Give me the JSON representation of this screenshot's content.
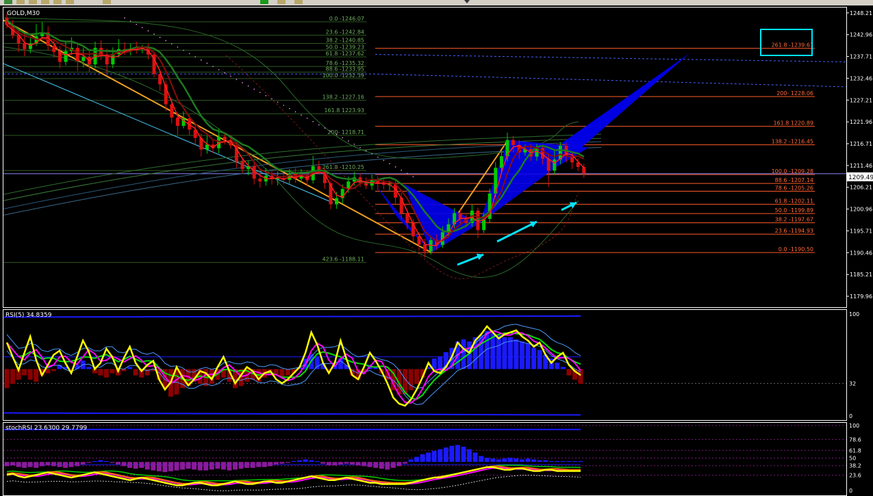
{
  "window": {
    "title": "GOLD,M30"
  },
  "toolbar": {
    "icons": [
      "app-icon",
      "tool-icon",
      "tool-icon",
      "tool-icon",
      "tool-icon",
      "tool-icon",
      "tool-icon",
      "plus-icon",
      "tool-icon",
      "tool-icon",
      "dropdown-icon"
    ]
  },
  "colors": {
    "background": "#000000",
    "bull_candle": "#00cc00",
    "bear_candle": "#dd1111",
    "fib_line_green": "#2f5a22",
    "fib_line_red": "#ff5a2a",
    "harmonic_fill": "#0000ee",
    "arrow": "#00e5ff",
    "highlight_box": "#00e5ff",
    "rsi_line": "#ffff00",
    "hist_pos": "#1a1aff",
    "hist_neg_rsi": "#8b0000",
    "hist_neg_stoch": "#8b1a9b"
  },
  "chart_data": [
    {
      "type": "candlestick",
      "title": "GOLD,M30",
      "ylim": [
        1177.5,
        1249.5
      ],
      "current_price": "1209.49",
      "y_ticks": [
        "1248.21",
        "1242.96",
        "1237.71",
        "1232.46",
        "1227.21",
        "1221.96",
        "1216.71",
        "1211.46",
        "1206.21",
        "1200.96",
        "1195.71",
        "1190.46",
        "1185.21",
        "1179.96"
      ],
      "candles": [
        [
          1247.0,
          1245.3,
          1248.0,
          1244.5
        ],
        [
          1245.3,
          1242.8,
          1246.5,
          1242.0
        ],
        [
          1242.8,
          1240.9,
          1244.0,
          1238.8
        ],
        [
          1240.9,
          1239.5,
          1243.2,
          1237.8
        ],
        [
          1239.5,
          1240.8,
          1242.6,
          1238.5
        ],
        [
          1240.8,
          1242.6,
          1245.5,
          1240.2
        ],
        [
          1242.6,
          1243.5,
          1246.0,
          1241.8
        ],
        [
          1243.5,
          1240.3,
          1245.0,
          1239.2
        ],
        [
          1240.3,
          1238.8,
          1241.5,
          1237.5
        ],
        [
          1238.8,
          1236.4,
          1240.2,
          1234.9
        ],
        [
          1236.4,
          1239.0,
          1241.2,
          1235.6
        ],
        [
          1239.0,
          1239.8,
          1242.3,
          1238.1
        ],
        [
          1239.8,
          1236.6,
          1241.1,
          1234.2
        ],
        [
          1236.6,
          1237.6,
          1239.9,
          1235.1
        ],
        [
          1237.6,
          1235.8,
          1239.4,
          1234.0
        ],
        [
          1235.8,
          1239.8,
          1241.3,
          1234.9
        ],
        [
          1239.8,
          1238.2,
          1241.6,
          1236.8
        ],
        [
          1238.2,
          1235.8,
          1239.6,
          1233.6
        ],
        [
          1235.8,
          1238.3,
          1239.9,
          1234.9
        ],
        [
          1238.3,
          1239.5,
          1241.9,
          1237.5
        ],
        [
          1239.5,
          1239.0,
          1241.2,
          1238.1
        ],
        [
          1239.0,
          1239.6,
          1240.8,
          1238.0
        ],
        [
          1239.6,
          1239.5,
          1241.3,
          1238.4
        ],
        [
          1239.5,
          1239.8,
          1240.5,
          1238.5
        ],
        [
          1239.8,
          1238.2,
          1240.8,
          1237.0
        ],
        [
          1238.2,
          1233.5,
          1238.9,
          1232.7
        ],
        [
          1233.5,
          1231.0,
          1234.5,
          1229.4
        ],
        [
          1231.0,
          1226.2,
          1231.9,
          1224.6
        ],
        [
          1226.2,
          1223.0,
          1227.4,
          1221.6
        ],
        [
          1223.0,
          1221.0,
          1224.4,
          1218.7
        ],
        [
          1221.0,
          1222.8,
          1224.5,
          1220.4
        ],
        [
          1222.8,
          1220.1,
          1223.7,
          1218.8
        ],
        [
          1220.1,
          1218.1,
          1221.2,
          1216.5
        ],
        [
          1218.1,
          1215.3,
          1219.1,
          1213.6
        ],
        [
          1215.3,
          1216.5,
          1218.7,
          1214.3
        ],
        [
          1216.5,
          1215.6,
          1217.7,
          1214.4
        ],
        [
          1215.6,
          1218.4,
          1220.4,
          1214.4
        ],
        [
          1218.4,
          1217.6,
          1219.1,
          1216.5
        ],
        [
          1217.6,
          1216.3,
          1218.8,
          1215.5
        ],
        [
          1216.3,
          1212.4,
          1217.1,
          1210.9
        ],
        [
          1212.4,
          1210.6,
          1213.4,
          1209.6
        ],
        [
          1210.6,
          1211.3,
          1212.5,
          1209.1
        ],
        [
          1211.3,
          1208.3,
          1212.2,
          1206.9
        ],
        [
          1208.3,
          1207.6,
          1209.5,
          1206.1
        ],
        [
          1207.6,
          1209.0,
          1210.8,
          1206.6
        ],
        [
          1209.0,
          1208.2,
          1210.2,
          1206.8
        ],
        [
          1208.2,
          1208.4,
          1210.0,
          1206.7
        ],
        [
          1208.4,
          1208.0,
          1209.5,
          1206.9
        ],
        [
          1208.0,
          1209.5,
          1210.6,
          1207.1
        ],
        [
          1209.5,
          1208.3,
          1210.8,
          1207.3
        ],
        [
          1208.3,
          1209.1,
          1210.6,
          1207.3
        ],
        [
          1209.1,
          1207.9,
          1210.3,
          1206.4
        ],
        [
          1207.9,
          1211.3,
          1213.8,
          1207.1
        ],
        [
          1211.3,
          1210.3,
          1212.6,
          1209.3
        ],
        [
          1210.3,
          1207.2,
          1210.9,
          1205.8
        ],
        [
          1207.2,
          1202.1,
          1207.7,
          1200.9
        ],
        [
          1202.1,
          1203.6,
          1205.1,
          1201.0
        ],
        [
          1203.6,
          1205.8,
          1206.9,
          1202.3
        ],
        [
          1205.8,
          1207.6,
          1208.8,
          1204.9
        ],
        [
          1207.6,
          1208.6,
          1209.9,
          1206.6
        ],
        [
          1208.6,
          1207.2,
          1209.6,
          1206.3
        ],
        [
          1207.2,
          1206.6,
          1208.6,
          1205.8
        ],
        [
          1206.6,
          1208.0,
          1209.3,
          1205.6
        ],
        [
          1208.0,
          1207.0,
          1208.8,
          1205.5
        ],
        [
          1207.0,
          1206.8,
          1208.4,
          1205.7
        ],
        [
          1206.8,
          1206.9,
          1207.8,
          1205.4
        ],
        [
          1206.9,
          1203.7,
          1207.7,
          1202.3
        ],
        [
          1203.7,
          1200.0,
          1204.9,
          1198.6
        ],
        [
          1200.0,
          1197.6,
          1200.8,
          1196.1
        ],
        [
          1197.6,
          1194.4,
          1198.6,
          1192.9
        ],
        [
          1194.4,
          1192.4,
          1195.4,
          1190.9
        ],
        [
          1192.4,
          1190.8,
          1193.8,
          1189.3
        ],
        [
          1190.8,
          1193.5,
          1194.5,
          1190.0
        ],
        [
          1193.5,
          1192.3,
          1194.9,
          1191.1
        ],
        [
          1192.3,
          1195.4,
          1196.8,
          1191.6
        ],
        [
          1195.4,
          1197.3,
          1198.7,
          1194.1
        ],
        [
          1197.3,
          1200.0,
          1201.2,
          1196.3
        ],
        [
          1200.0,
          1198.7,
          1200.9,
          1197.4
        ],
        [
          1198.7,
          1197.6,
          1199.6,
          1196.6
        ],
        [
          1197.6,
          1200.6,
          1202.0,
          1196.7
        ],
        [
          1200.6,
          1195.9,
          1201.3,
          1194.0
        ],
        [
          1195.9,
          1198.6,
          1200.1,
          1195.2
        ],
        [
          1198.6,
          1204.7,
          1205.9,
          1197.7
        ],
        [
          1204.7,
          1210.9,
          1212.3,
          1203.8
        ],
        [
          1210.9,
          1213.7,
          1215.0,
          1209.6
        ],
        [
          1213.7,
          1217.6,
          1219.4,
          1212.5
        ],
        [
          1217.6,
          1216.4,
          1218.6,
          1214.6
        ],
        [
          1216.4,
          1214.6,
          1217.6,
          1213.0
        ],
        [
          1214.6,
          1215.4,
          1216.5,
          1213.8
        ],
        [
          1215.4,
          1213.6,
          1216.6,
          1212.5
        ],
        [
          1213.6,
          1215.7,
          1216.6,
          1212.6
        ],
        [
          1215.7,
          1213.1,
          1216.4,
          1211.7
        ],
        [
          1213.1,
          1210.2,
          1214.4,
          1206.3
        ],
        [
          1210.2,
          1212.9,
          1215.0,
          1209.3
        ],
        [
          1212.9,
          1216.2,
          1217.1,
          1211.8
        ],
        [
          1216.2,
          1213.8,
          1216.9,
          1212.2
        ],
        [
          1213.8,
          1212.2,
          1214.6,
          1210.6
        ],
        [
          1212.2,
          1211.1,
          1213.2,
          1210.1
        ],
        [
          1211.1,
          1209.5,
          1211.9,
          1208.5
        ]
      ],
      "fibonacci_left": [
        {
          "label": "0.0 -1246.07",
          "price": 1246.07
        },
        {
          "label": "23.6 -1242.84",
          "price": 1242.84
        },
        {
          "label": "38.2 -1240.85",
          "price": 1240.85
        },
        {
          "label": "50.0 -1239.23",
          "price": 1239.23
        },
        {
          "label": "61.8 -1237.62",
          "price": 1237.62
        },
        {
          "label": "78.6 -1235.32",
          "price": 1235.32
        },
        {
          "label": "88.6 -1233.95",
          "price": 1233.95
        },
        {
          "label": "100.0 -1232.39",
          "price": 1232.39
        },
        {
          "label": "138.2 -1227.16",
          "price": 1227.16
        },
        {
          "label": "161.8 1223.93",
          "price": 1223.93
        },
        {
          "label": "200- 1218.71",
          "price": 1218.71
        },
        {
          "label": "261.8 -1210.25",
          "price": 1210.25
        },
        {
          "label": "423.6 -1188.11",
          "price": 1188.11
        }
      ],
      "fibonacci_right": [
        {
          "label": "261.8 -1239.67",
          "price": 1239.67
        },
        {
          "label": "200- 1228.06",
          "price": 1228.06
        },
        {
          "label": "161.8 1220.89",
          "price": 1220.89
        },
        {
          "label": "138.2 -1216.45",
          "price": 1216.45
        },
        {
          "label": "100.0 -1209.28",
          "price": 1209.28
        },
        {
          "label": "88.6 -1207.14",
          "price": 1207.14
        },
        {
          "label": "78.6 -1205.26",
          "price": 1205.26
        },
        {
          "label": "61.8 -1202.11",
          "price": 1202.11
        },
        {
          "label": "50.0 -1199.89",
          "price": 1199.89
        },
        {
          "label": "38.2 -1197.67",
          "price": 1197.67
        },
        {
          "label": "23.6 -1194.93",
          "price": 1194.93
        },
        {
          "label": "0.0 -1190.50",
          "price": 1190.5
        }
      ]
    },
    {
      "type": "line",
      "title": "RSI(5) 34.8359",
      "ylim": [
        0,
        100
      ],
      "y_ticks": [
        "100",
        "32",
        "0"
      ],
      "level": 32,
      "rsi": [
        72,
        58,
        45,
        62,
        78,
        55,
        40,
        50,
        60,
        64,
        52,
        42,
        58,
        74,
        63,
        46,
        52,
        66,
        58,
        44,
        57,
        68,
        52,
        44,
        50,
        54,
        36,
        26,
        33,
        48,
        38,
        30,
        36,
        44,
        42,
        36,
        48,
        58,
        44,
        32,
        40,
        48,
        44,
        36,
        42,
        44,
        36,
        32,
        36,
        42,
        48,
        62,
        82,
        70,
        52,
        42,
        52,
        74,
        56,
        40,
        36,
        48,
        62,
        54,
        44,
        32,
        18,
        12,
        10,
        16,
        26,
        38,
        52,
        44,
        42,
        48,
        58,
        72,
        66,
        62,
        74,
        80,
        88,
        82,
        76,
        80,
        82,
        84,
        78,
        74,
        68,
        72,
        60,
        52,
        58,
        62,
        50,
        44,
        40
      ],
      "histogram": [
        -18,
        -14,
        -10,
        -6,
        -10,
        -12,
        -6,
        -4,
        -2,
        4,
        2,
        -2,
        4,
        8,
        2,
        -4,
        -6,
        -8,
        -4,
        -6,
        -2,
        2,
        -6,
        -8,
        -6,
        -2,
        -10,
        -18,
        -26,
        -24,
        -18,
        -16,
        -12,
        -14,
        -16,
        -14,
        -10,
        -8,
        -12,
        -18,
        -16,
        -12,
        -10,
        -12,
        -8,
        -6,
        -6,
        -8,
        -6,
        -4,
        2,
        10,
        14,
        12,
        6,
        -2,
        4,
        10,
        4,
        -6,
        -10,
        -4,
        4,
        2,
        -4,
        -10,
        -20,
        -24,
        -24,
        -20,
        -14,
        -8,
        2,
        10,
        12,
        16,
        20,
        26,
        28,
        26,
        30,
        32,
        36,
        34,
        32,
        30,
        30,
        28,
        26,
        24,
        20,
        18,
        14,
        10,
        6,
        2,
        -6,
        -10,
        -14
      ]
    },
    {
      "type": "line",
      "title": "stochRSI 23.6300 29.7799",
      "ylim": [
        0,
        100
      ],
      "y_ticks": [
        "100",
        "78.6",
        "61.8",
        "50",
        "38.2",
        "23.6",
        "0"
      ],
      "stoch": [
        24,
        26,
        22,
        20,
        22,
        24,
        26,
        28,
        26,
        24,
        22,
        20,
        22,
        24,
        26,
        28,
        26,
        24,
        22,
        20,
        18,
        16,
        18,
        20,
        18,
        16,
        14,
        12,
        10,
        8,
        8,
        10,
        12,
        12,
        10,
        8,
        8,
        10,
        12,
        14,
        12,
        10,
        10,
        12,
        14,
        14,
        12,
        12,
        14,
        16,
        18,
        20,
        22,
        20,
        18,
        16,
        16,
        18,
        20,
        18,
        16,
        14,
        12,
        12,
        10,
        10,
        10,
        10,
        10,
        12,
        14,
        16,
        18,
        20,
        20,
        22,
        24,
        26,
        28,
        30,
        32,
        34,
        36,
        36,
        34,
        32,
        32,
        34,
        34,
        32,
        30,
        30,
        32,
        32,
        30,
        30,
        30,
        30,
        30
      ],
      "histogram": [
        -10,
        -8,
        -12,
        -14,
        -12,
        -14,
        -10,
        -8,
        -10,
        -12,
        -14,
        -12,
        -10,
        -6,
        -2,
        2,
        4,
        2,
        -2,
        -6,
        -10,
        -14,
        -16,
        -14,
        -18,
        -20,
        -22,
        -24,
        -22,
        -20,
        -18,
        -16,
        -18,
        -20,
        -20,
        -18,
        -16,
        -18,
        -20,
        -18,
        -16,
        -14,
        -14,
        -12,
        -12,
        -10,
        -6,
        -4,
        -2,
        2,
        4,
        6,
        4,
        2,
        -4,
        -8,
        -8,
        -6,
        -4,
        -6,
        -8,
        -10,
        -12,
        -14,
        -16,
        -18,
        -14,
        -10,
        -4,
        6,
        12,
        18,
        22,
        26,
        30,
        34,
        38,
        40,
        36,
        30,
        22,
        14,
        10,
        8,
        6,
        8,
        10,
        8,
        6,
        8,
        6,
        4,
        4,
        2,
        2,
        2,
        2,
        2,
        2
      ]
    }
  ]
}
